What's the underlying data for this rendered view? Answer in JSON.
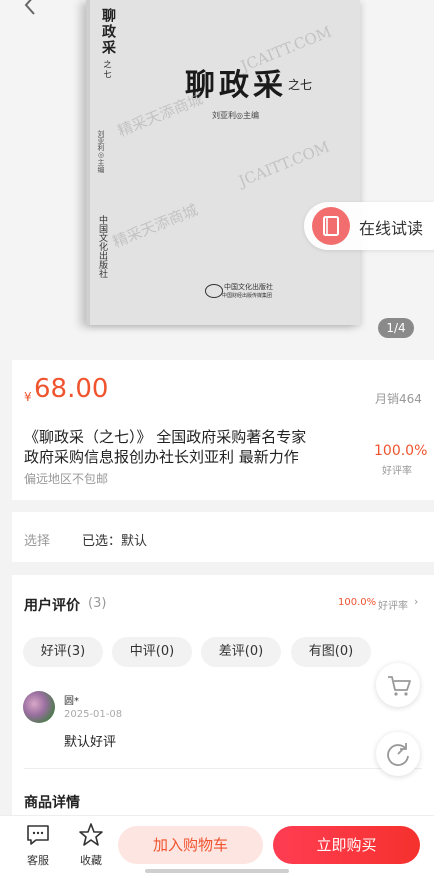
{
  "gallery": {
    "book_cover": {
      "spine_title": "聊政采",
      "spine_sub": "之七",
      "title": "聊政采",
      "subtitle": "之七",
      "editor": "刘亚利◎主编",
      "spine_editor": "刘亚利◎主编",
      "spine_publisher": "中国文化出版社",
      "publisher_en": "中国财经出版传媒集团"
    },
    "watermarks": [
      "精采天添商城",
      "JCAITT.COM",
      "精采天添商城",
      "JCAITT.COM"
    ],
    "trial_read_label": "在线试读",
    "pager": "1/4"
  },
  "product": {
    "currency": "¥",
    "price": "68.00",
    "monthly_sales": "月销464",
    "title_line1": "《聊政采（之七）》 全国政府采购著名专家",
    "title_line2": "政府采购信息报创办社长刘亚利 最新力作",
    "shipping_note": "偏远地区不包邮",
    "positive_rate": "100.0%",
    "positive_rate_label": "好评率"
  },
  "select": {
    "label": "选择",
    "value": "已选：默认"
  },
  "reviews": {
    "title": "用户评价",
    "count": "(3)",
    "rate": "100.0%",
    "rate_label": "好评率",
    "chevron": "›",
    "filters": [
      "好评(3)",
      "中评(0)",
      "差评(0)",
      "有图(0)"
    ],
    "items": [
      {
        "user": "圆*",
        "date": "2025-01-08",
        "text": "默认好评"
      }
    ]
  },
  "details": {
    "title": "商品详情"
  },
  "bottom_bar": {
    "service_label": "客服",
    "favorite_label": "收藏",
    "add_cart_label": "加入购物车",
    "buy_now_label": "立即购买"
  },
  "icons": {
    "back": "chevron-left-icon",
    "trial": "book-icon",
    "cart": "cart-icon",
    "refresh": "refresh-icon",
    "service": "chat-icon",
    "favorite": "star-icon"
  },
  "colors": {
    "accent": "#f0542f",
    "buy": "#f5312d",
    "cart_bg": "#fde5e1"
  }
}
